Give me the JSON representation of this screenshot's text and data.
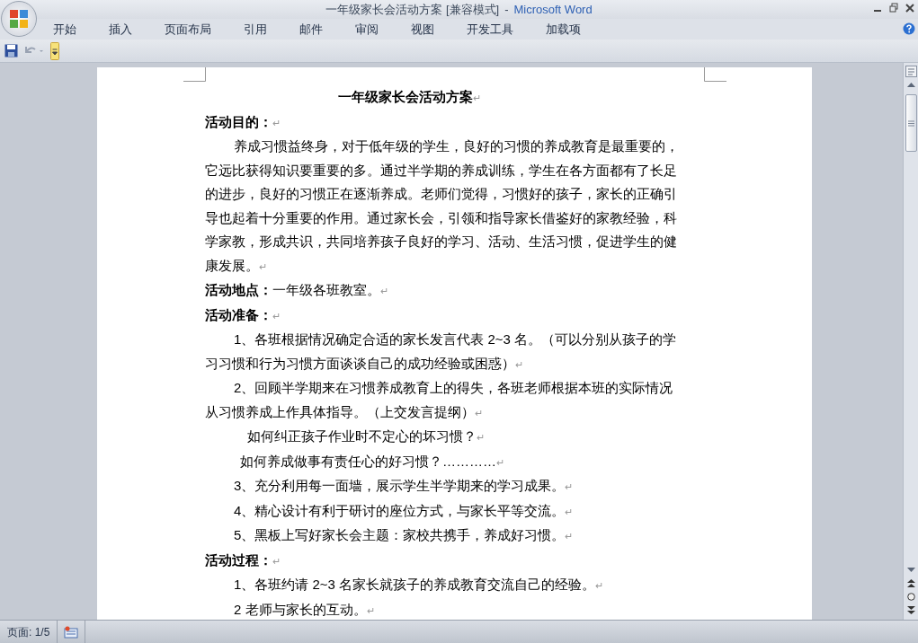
{
  "window": {
    "title": "一年级家长会活动方案 [兼容模式]",
    "separator": "-",
    "app": "Microsoft Word"
  },
  "ribbon_tabs": [
    {
      "label": "开始"
    },
    {
      "label": "插入"
    },
    {
      "label": "页面布局"
    },
    {
      "label": "引用"
    },
    {
      "label": "邮件"
    },
    {
      "label": "审阅"
    },
    {
      "label": "视图"
    },
    {
      "label": "开发工具"
    },
    {
      "label": "加载项"
    }
  ],
  "document": {
    "blocks": [
      {
        "kind": "title",
        "lines": [
          "一年级家长会活动方案"
        ],
        "mark": "↵"
      },
      {
        "kind": "heading",
        "lines": [
          "**活动目的：**"
        ],
        "mark": "↵"
      },
      {
        "kind": "para",
        "lines": [
          "养成习惯益终身，对于低年级的学生，良好的习惯的养成教育是最重要的，",
          "它远比获得知识要重要的多。通过半学期的养成训练，学生在各方面都有了长足",
          "的进步，良好的习惯正在逐渐养成。老师们觉得，习惯好的孩子，家长的正确引",
          "导也起着十分重要的作用。通过家长会，引领和指导家长借鉴好的家教经验，科",
          "学家教，形成共识，共同培养孩子良好的学习、活动、生活习惯，促进学生的健",
          "康发展。"
        ],
        "mark": "↵"
      },
      {
        "kind": "heading",
        "lines": [
          "**活动地点：**一年级各班教室。"
        ],
        "mark": "↵"
      },
      {
        "kind": "heading",
        "lines": [
          "**活动准备：**"
        ],
        "mark": "↵"
      },
      {
        "kind": "para",
        "lines": [
          "1、各班根据情况确定合适的家长发言代表 2~3 名。（可以分别从孩子的学",
          "习习惯和行为习惯方面谈谈自己的成功经验或困惑）"
        ],
        "mark": "↵"
      },
      {
        "kind": "para",
        "lines": [
          "2、回顾半学期来在习惯养成教育上的得失，各班老师根据本班的实际情况",
          "从习惯养成上作具体指导。（上交发言提纲）"
        ],
        "mark": "↵"
      },
      {
        "kind": "question",
        "lines": [
          "如何纠正孩子作业时不定心的坏习惯？"
        ],
        "mark": "↵"
      },
      {
        "kind": "subquestion",
        "lines": [
          "如何养成做事有责任心的好习惯？…………"
        ],
        "mark": "↵"
      },
      {
        "kind": "para",
        "lines": [
          "3、充分利用每一面墙，展示学生半学期来的学习成果。"
        ],
        "mark": "↵"
      },
      {
        "kind": "para",
        "lines": [
          "4、精心设计有利于研讨的座位方式，与家长平等交流。"
        ],
        "mark": "↵"
      },
      {
        "kind": "para",
        "lines": [
          "5、黑板上写好家长会主题：家校共携手，养成好习惯。"
        ],
        "mark": "↵"
      },
      {
        "kind": "heading",
        "lines": [
          "**活动过程：**"
        ],
        "mark": "↵"
      },
      {
        "kind": "para",
        "lines": [
          "1、各班约请 2~3 名家长就孩子的养成教育交流自己的经验。"
        ],
        "mark": "↵"
      },
      {
        "kind": "para",
        "lines": [
          "2 老师与家长的互动。"
        ],
        "mark": "↵"
      }
    ]
  },
  "status_bar": {
    "page": "页面: 1/5"
  }
}
